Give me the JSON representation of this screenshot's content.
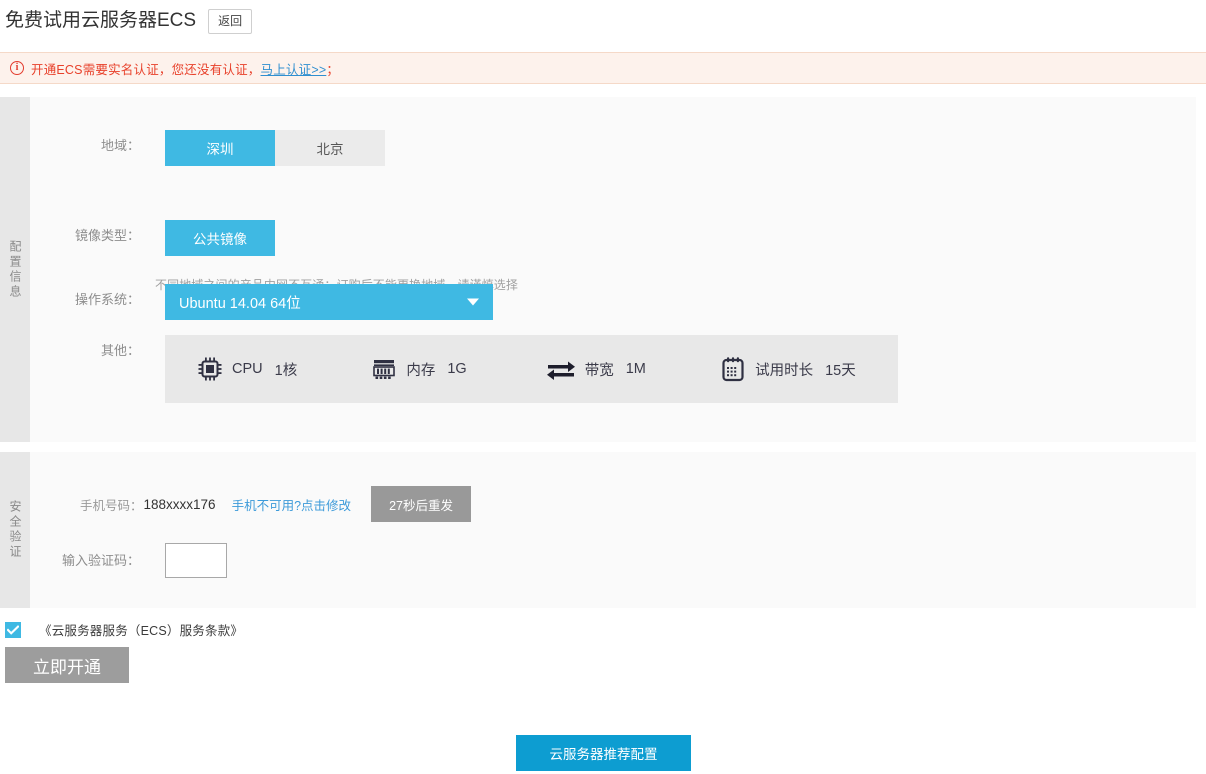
{
  "header": {
    "title": "免费试用云服务器ECS",
    "back_label": "返回"
  },
  "alert": {
    "icon": "info-circle-icon",
    "message": "开通ECS需要实名认证，您还没有认证，",
    "link_text": "马上认证>>",
    "tail": "；",
    "text_color": "#e8402a",
    "link_color": "#2f8fd0",
    "background": "#fdf2ec"
  },
  "config_panel": {
    "tab_label": "配置信息",
    "region": {
      "label": "地域：",
      "options": [
        {
          "label": "深圳",
          "selected": true
        },
        {
          "label": "北京",
          "selected": false
        }
      ],
      "hint": "不同地域之间的产品内网不互通；订购后不能更换地域，请谨慎选择"
    },
    "image_type": {
      "label": "镜像类型：",
      "selected": "公共镜像"
    },
    "os": {
      "label": "操作系统：",
      "selected": "Ubuntu 14.04 64位",
      "caret": "chevron-down-icon"
    },
    "other": {
      "label": "其他：",
      "specs": [
        {
          "icon": "cpu-icon",
          "name": "CPU",
          "value": "1核"
        },
        {
          "icon": "memory-icon",
          "name": "内存",
          "value": "1G"
        },
        {
          "icon": "bandwidth-icon",
          "name": "带宽",
          "value": "1M"
        },
        {
          "icon": "calendar-icon",
          "name": "试用时长",
          "value": "15天"
        }
      ]
    }
  },
  "security_panel": {
    "tab_label": "安全验证",
    "phone": {
      "label": "手机号码：",
      "number": "188xxxx176",
      "change_link": "手机不可用?点击修改",
      "resend_label": "27秒后重发"
    },
    "captcha": {
      "label": "输入验证码：",
      "value": "",
      "placeholder": ""
    }
  },
  "footer": {
    "terms_checked": true,
    "terms_label": "《云服务器服务（ECS）服务条款》",
    "submit_label": "立即开通",
    "recommend_label": "云服务器推荐配置"
  },
  "colors": {
    "accent_light": "#3fb9e3",
    "accent_dark": "#0d9dd1",
    "panel_bg": "#fafafa",
    "tab_bg": "#e7e7e7",
    "spec_bg": "#e8e8e8",
    "disabled_gray": "#999999"
  }
}
